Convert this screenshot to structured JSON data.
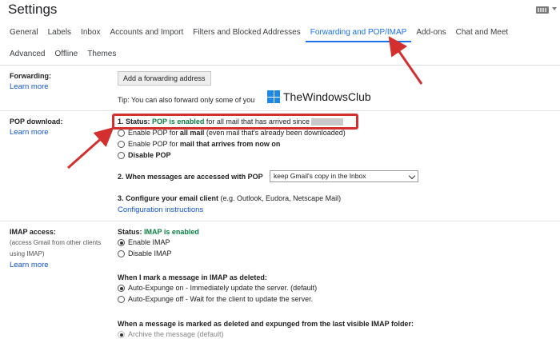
{
  "title": "Settings",
  "tabs_row1": [
    "General",
    "Labels",
    "Inbox",
    "Accounts and Import",
    "Filters and Blocked Addresses",
    "Forwarding and POP/IMAP",
    "Add-ons",
    "Chat and Meet"
  ],
  "tabs_row2": [
    "Advanced",
    "Offline",
    "Themes"
  ],
  "forwarding": {
    "label": "Forwarding:",
    "learn_more": "Learn more",
    "button": "Add a forwarding address",
    "tip": "Tip: You can also forward only some of you"
  },
  "watermark": "TheWindowsClub",
  "pop": {
    "label": "POP download:",
    "learn_more": "Learn more",
    "status_prefix": "1. Status: ",
    "status_value": "POP is enabled",
    "status_suffix": " for all mail that has arrived since",
    "opt_all_pre": "Enable POP for ",
    "opt_all_bold": "all mail",
    "opt_all_post": " (even mail that's already been downloaded)",
    "opt_now_pre": "Enable POP for ",
    "opt_now_bold": "mail that arrives from now on",
    "opt_disable": "Disable POP",
    "q2": "2. When messages are accessed with POP",
    "q2_select": "keep Gmail's copy in the Inbox",
    "q3_bold": "3. Configure your email client",
    "q3_rest": " (e.g. Outlook, Eudora, Netscape Mail)",
    "config_link": "Configuration instructions"
  },
  "imap": {
    "label": "IMAP access:",
    "sub": "(access Gmail from other clients using IMAP)",
    "learn_more": "Learn more",
    "status_prefix": "Status: ",
    "status_value": "IMAP is enabled",
    "enable": "Enable IMAP",
    "disable": "Disable IMAP",
    "deleted_title": "When I mark a message in IMAP as deleted:",
    "expunge_on": "Auto-Expunge on - Immediately update the server. (default)",
    "expunge_off": "Auto-Expunge off - Wait for the client to update the server.",
    "expunged_title": "When a message is marked as deleted and expunged from the last visible IMAP folder:",
    "archive": "Archive the message (default)"
  },
  "colors": {
    "accent": "#1a73e8",
    "green": "#0b8043",
    "annotation": "#d32f2f"
  }
}
